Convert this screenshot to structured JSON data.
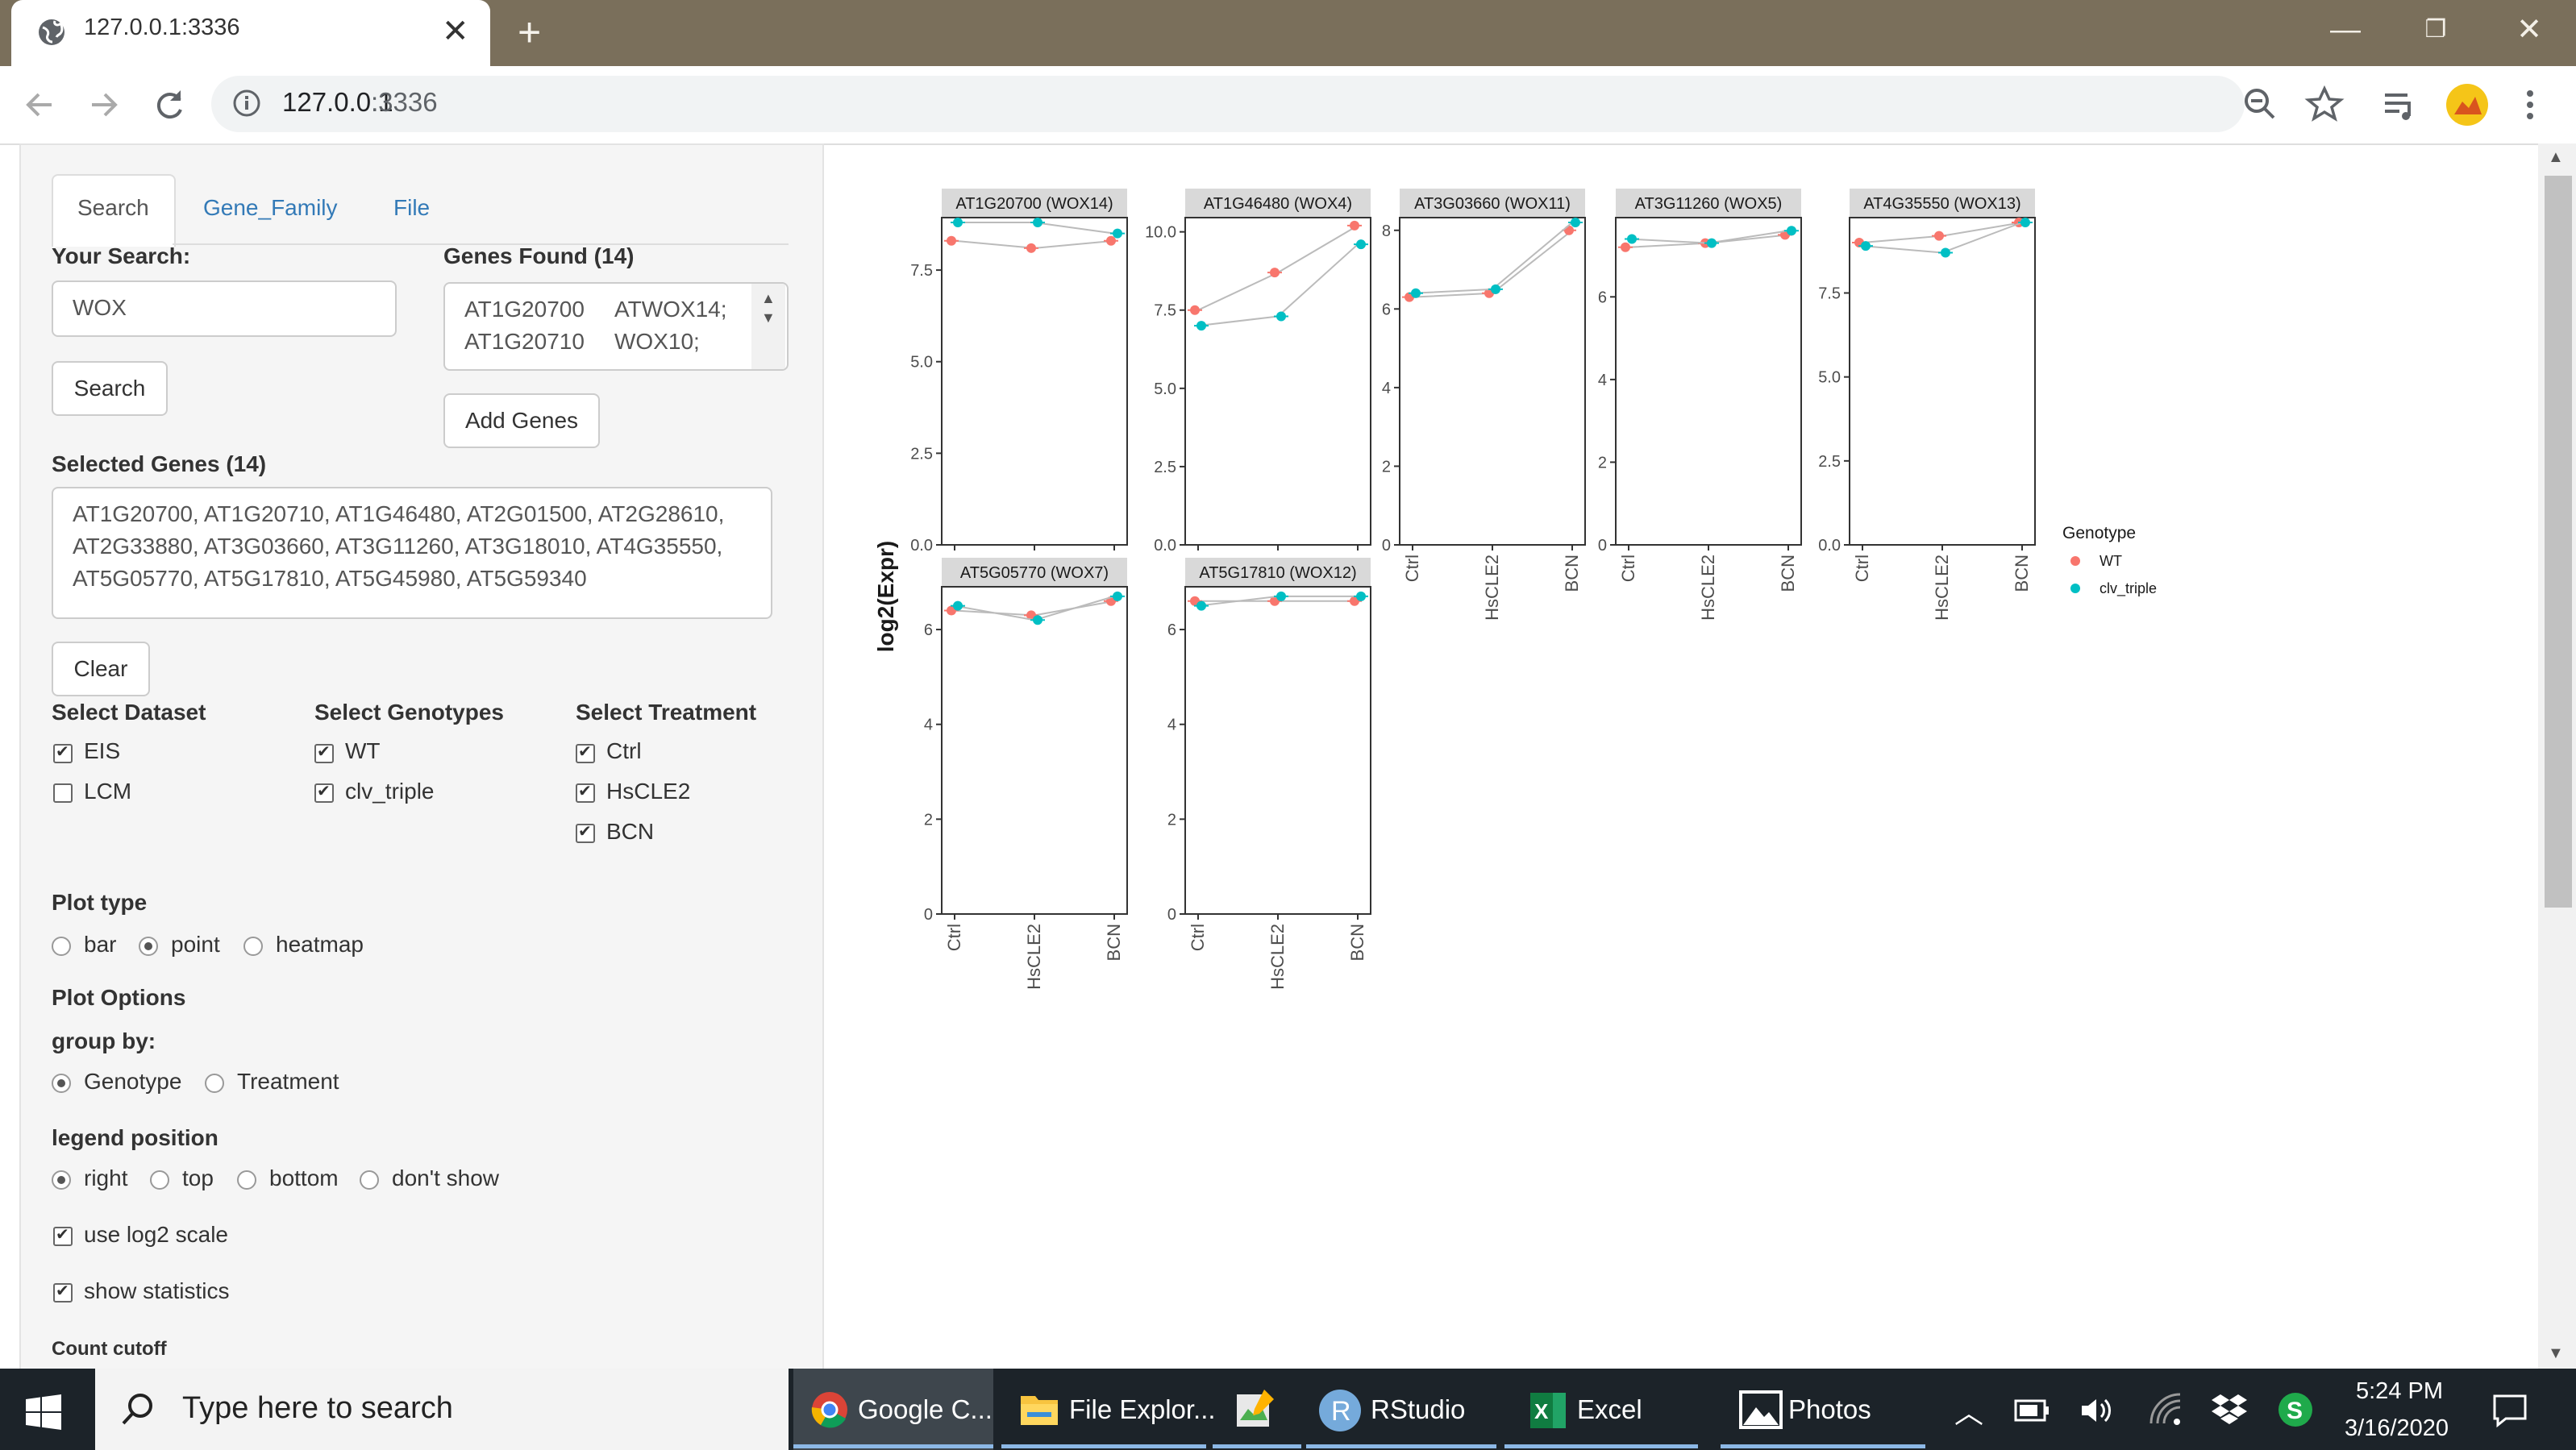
{
  "browser": {
    "tab_title": "127.0.0.1:3336",
    "url_host": "127.0.0.1",
    "url_port": ":3336"
  },
  "tabs": [
    "Search",
    "Gene_Family",
    "File"
  ],
  "search": {
    "your_search_label": "Your Search:",
    "query": "WOX",
    "button": "Search"
  },
  "genes_found": {
    "label": "Genes Found (14)",
    "rows": [
      [
        "AT1G20700",
        "ATWOX14;"
      ],
      [
        "AT1G20710",
        "WOX10;"
      ]
    ],
    "add_button": "Add Genes"
  },
  "selected": {
    "label": "Selected Genes (14)",
    "lines": [
      "AT1G20700, AT1G20710, AT1G46480, AT2G01500, AT2G28610,",
      "AT2G33880, AT3G03660, AT3G11260, AT3G18010, AT4G35550,",
      "AT5G05770, AT5G17810, AT5G45980, AT5G59340"
    ],
    "clear_button": "Clear"
  },
  "dataset": {
    "label": "Select Dataset",
    "options": [
      {
        "label": "EIS",
        "checked": true
      },
      {
        "label": "LCM",
        "checked": false
      }
    ]
  },
  "genotypes": {
    "label": "Select Genotypes",
    "options": [
      {
        "label": "WT",
        "checked": true
      },
      {
        "label": "clv_triple",
        "checked": true
      }
    ]
  },
  "treatment": {
    "label": "Select Treatment",
    "options": [
      {
        "label": "Ctrl",
        "checked": true
      },
      {
        "label": "HsCLE2",
        "checked": true
      },
      {
        "label": "BCN",
        "checked": true
      }
    ]
  },
  "plot_type": {
    "label": "Plot type",
    "options": [
      {
        "label": "bar",
        "selected": false
      },
      {
        "label": "point",
        "selected": true
      },
      {
        "label": "heatmap",
        "selected": false
      }
    ]
  },
  "plot_options_label": "Plot Options",
  "group_by": {
    "label": "group by:",
    "options": [
      {
        "label": "Genotype",
        "selected": true
      },
      {
        "label": "Treatment",
        "selected": false
      }
    ]
  },
  "legend_position": {
    "label": "legend position",
    "options": [
      {
        "label": "right",
        "selected": true
      },
      {
        "label": "top",
        "selected": false
      },
      {
        "label": "bottom",
        "selected": false
      },
      {
        "label": "don't show",
        "selected": false
      }
    ]
  },
  "use_log2": {
    "label": "use log2 scale",
    "checked": true
  },
  "show_stats": {
    "label": "show statistics",
    "checked": true
  },
  "count_cutoff_label": "Count cutoff",
  "taskbar": {
    "search_placeholder": "Type here to search",
    "apps": [
      "Google C...",
      "File Explor...",
      "RStudio",
      "Excel",
      "Photos"
    ],
    "time": "5:24 PM",
    "date": "3/16/2020"
  },
  "chart_data": {
    "type": "scatter",
    "ylabel": "log2(Expr)",
    "categories": [
      "Ctrl",
      "HsCLE2",
      "BCN"
    ],
    "legend": {
      "title": "Genotype",
      "position": "right",
      "entries": [
        "WT",
        "clv_triple"
      ]
    },
    "colors": {
      "WT": "#f8766d",
      "clv_triple": "#00bfc4",
      "panel_border": "#333333",
      "strip_bg": "#d9d9d9",
      "line": "#bbbbbb"
    },
    "panels": [
      {
        "title": "AT1G20700 (WOX14)",
        "ylim": [
          0,
          8.8
        ],
        "ticks": [
          0,
          2.5,
          5.0,
          7.5
        ],
        "tick_labels": [
          "0.0",
          "2.5",
          "5.0",
          "7.5"
        ],
        "series": [
          {
            "name": "WT",
            "values": [
              8.3,
              8.1,
              8.3
            ]
          },
          {
            "name": "clv_triple",
            "values": [
              8.8,
              8.8,
              8.5
            ]
          }
        ]
      },
      {
        "title": "AT1G46480 (WOX4)",
        "ylim": [
          0,
          10.3
        ],
        "ticks": [
          0,
          2.5,
          5.0,
          7.5,
          10.0
        ],
        "tick_labels": [
          "0.0",
          "2.5",
          "5.0",
          "7.5",
          "10.0"
        ],
        "series": [
          {
            "name": "WT",
            "values": [
              7.5,
              8.7,
              10.2
            ]
          },
          {
            "name": "clv_triple",
            "values": [
              7.0,
              7.3,
              9.6
            ]
          }
        ]
      },
      {
        "title": "AT3G03660 (WOX11)",
        "ylim": [
          0,
          8.2
        ],
        "ticks": [
          0,
          2,
          4,
          6,
          8
        ],
        "tick_labels": [
          "0",
          "2",
          "4",
          "6",
          "8"
        ],
        "series": [
          {
            "name": "WT",
            "values": [
              6.3,
              6.4,
              8.0
            ]
          },
          {
            "name": "clv_triple",
            "values": [
              6.4,
              6.5,
              8.2
            ]
          }
        ]
      },
      {
        "title": "AT3G11260 (WOX5)",
        "ylim": [
          0,
          7.8
        ],
        "ticks": [
          0,
          2,
          4,
          6
        ],
        "tick_labels": [
          "0",
          "2",
          "4",
          "6"
        ],
        "series": [
          {
            "name": "WT",
            "values": [
              7.2,
              7.3,
              7.5
            ]
          },
          {
            "name": "clv_triple",
            "values": [
              7.4,
              7.3,
              7.6
            ]
          }
        ]
      },
      {
        "title": "AT4G35550 (WOX13)",
        "ylim": [
          0,
          9.6
        ],
        "ticks": [
          0,
          2.5,
          5.0,
          7.5
        ],
        "tick_labels": [
          "0.0",
          "2.5",
          "5.0",
          "7.5"
        ],
        "series": [
          {
            "name": "WT",
            "values": [
              9.0,
              9.2,
              9.6
            ]
          },
          {
            "name": "clv_triple",
            "values": [
              8.9,
              8.7,
              9.6
            ]
          }
        ]
      },
      {
        "title": "AT5G05770 (WOX7)",
        "ylim": [
          0,
          6.8
        ],
        "ticks": [
          0,
          2,
          4,
          6
        ],
        "tick_labels": [
          "0",
          "2",
          "4",
          "6"
        ],
        "series": [
          {
            "name": "WT",
            "values": [
              6.4,
              6.3,
              6.6
            ]
          },
          {
            "name": "clv_triple",
            "values": [
              6.5,
              6.2,
              6.7
            ]
          }
        ]
      },
      {
        "title": "AT5G17810 (WOX12)",
        "ylim": [
          0,
          6.8
        ],
        "ticks": [
          0,
          2,
          4,
          6
        ],
        "tick_labels": [
          "0",
          "2",
          "4",
          "6"
        ],
        "series": [
          {
            "name": "WT",
            "values": [
              6.6,
              6.6,
              6.6
            ]
          },
          {
            "name": "clv_triple",
            "values": [
              6.5,
              6.7,
              6.7
            ]
          }
        ]
      }
    ]
  }
}
